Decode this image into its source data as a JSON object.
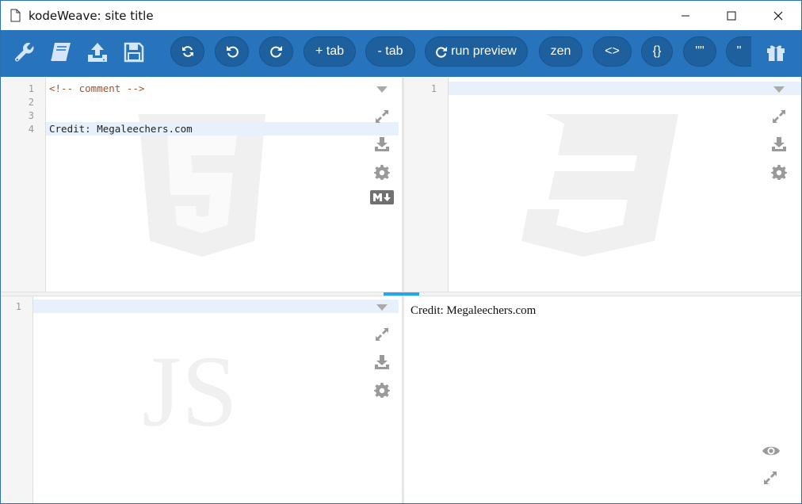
{
  "window": {
    "title": "kodeWeave: site title",
    "file_icon": "file-icon",
    "controls": [
      "minimize-icon",
      "maximize-icon",
      "close-icon"
    ]
  },
  "toolbar": {
    "icons": [
      "wrench-icon",
      "book-icon",
      "upload-icon",
      "save-icon"
    ],
    "buttons": {
      "refresh": "",
      "undo": "",
      "redo": "",
      "add_tab": "+ tab",
      "remove_tab": "- tab",
      "run_preview": "run preview",
      "zen": "zen",
      "tags": "<>",
      "braces": "{}",
      "double_quotes": "\"\"",
      "single_quotes": "''"
    },
    "gift_icon": "gift-icon",
    "colors": {
      "bar": "#2774bd",
      "button": "#1e5f9e"
    }
  },
  "html_editor": {
    "watermark": "html5-logo",
    "lines": [
      {
        "num": "1",
        "text": "<!-- comment -->",
        "type": "comment"
      },
      {
        "num": "2",
        "text": "",
        "type": "text"
      },
      {
        "num": "3",
        "text": "",
        "type": "text"
      },
      {
        "num": "4",
        "text": "Credit: Megaleechers.com",
        "type": "text"
      }
    ],
    "active_line": 4,
    "icons": [
      "chevron-down-icon",
      "expand-icon",
      "download-icon",
      "gear-icon",
      "markdown-icon"
    ]
  },
  "css_editor": {
    "watermark": "css3-logo",
    "lines": [
      {
        "num": "1",
        "text": ""
      }
    ],
    "icons": [
      "chevron-down-icon",
      "expand-icon",
      "download-icon",
      "gear-icon"
    ]
  },
  "js_editor": {
    "watermark": "JS",
    "lines": [
      {
        "num": "1",
        "text": ""
      }
    ],
    "icons": [
      "chevron-down-icon",
      "expand-icon",
      "download-icon",
      "gear-icon"
    ]
  },
  "preview": {
    "content": "Credit: Megaleechers.com",
    "icons": [
      "eye-icon",
      "expand-icon"
    ]
  },
  "accent": "#29a3ea"
}
